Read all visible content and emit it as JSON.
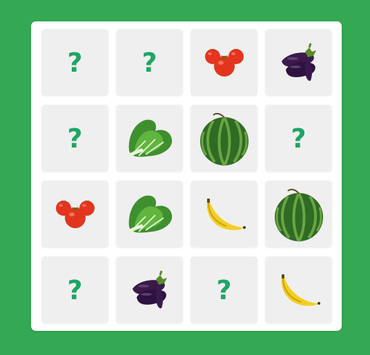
{
  "colors": {
    "background": "#34a853",
    "board": "#ffffff",
    "card": "#efefef",
    "question_mark": "#1fa565"
  },
  "board": {
    "cards": [
      {
        "state": "hidden",
        "label": "?"
      },
      {
        "state": "hidden",
        "label": "?"
      },
      {
        "state": "revealed",
        "icon": "tomato-icon"
      },
      {
        "state": "revealed",
        "icon": "eggplant-icon"
      },
      {
        "state": "hidden",
        "label": "?"
      },
      {
        "state": "revealed",
        "icon": "lettuce-icon"
      },
      {
        "state": "revealed",
        "icon": "watermelon-icon"
      },
      {
        "state": "hidden",
        "label": "?"
      },
      {
        "state": "revealed",
        "icon": "tomato-icon"
      },
      {
        "state": "revealed",
        "icon": "lettuce-icon"
      },
      {
        "state": "revealed",
        "icon": "banana-icon"
      },
      {
        "state": "revealed",
        "icon": "watermelon-icon"
      },
      {
        "state": "hidden",
        "label": "?"
      },
      {
        "state": "revealed",
        "icon": "eggplant-icon"
      },
      {
        "state": "hidden",
        "label": "?"
      },
      {
        "state": "revealed",
        "icon": "banana-icon"
      }
    ]
  }
}
